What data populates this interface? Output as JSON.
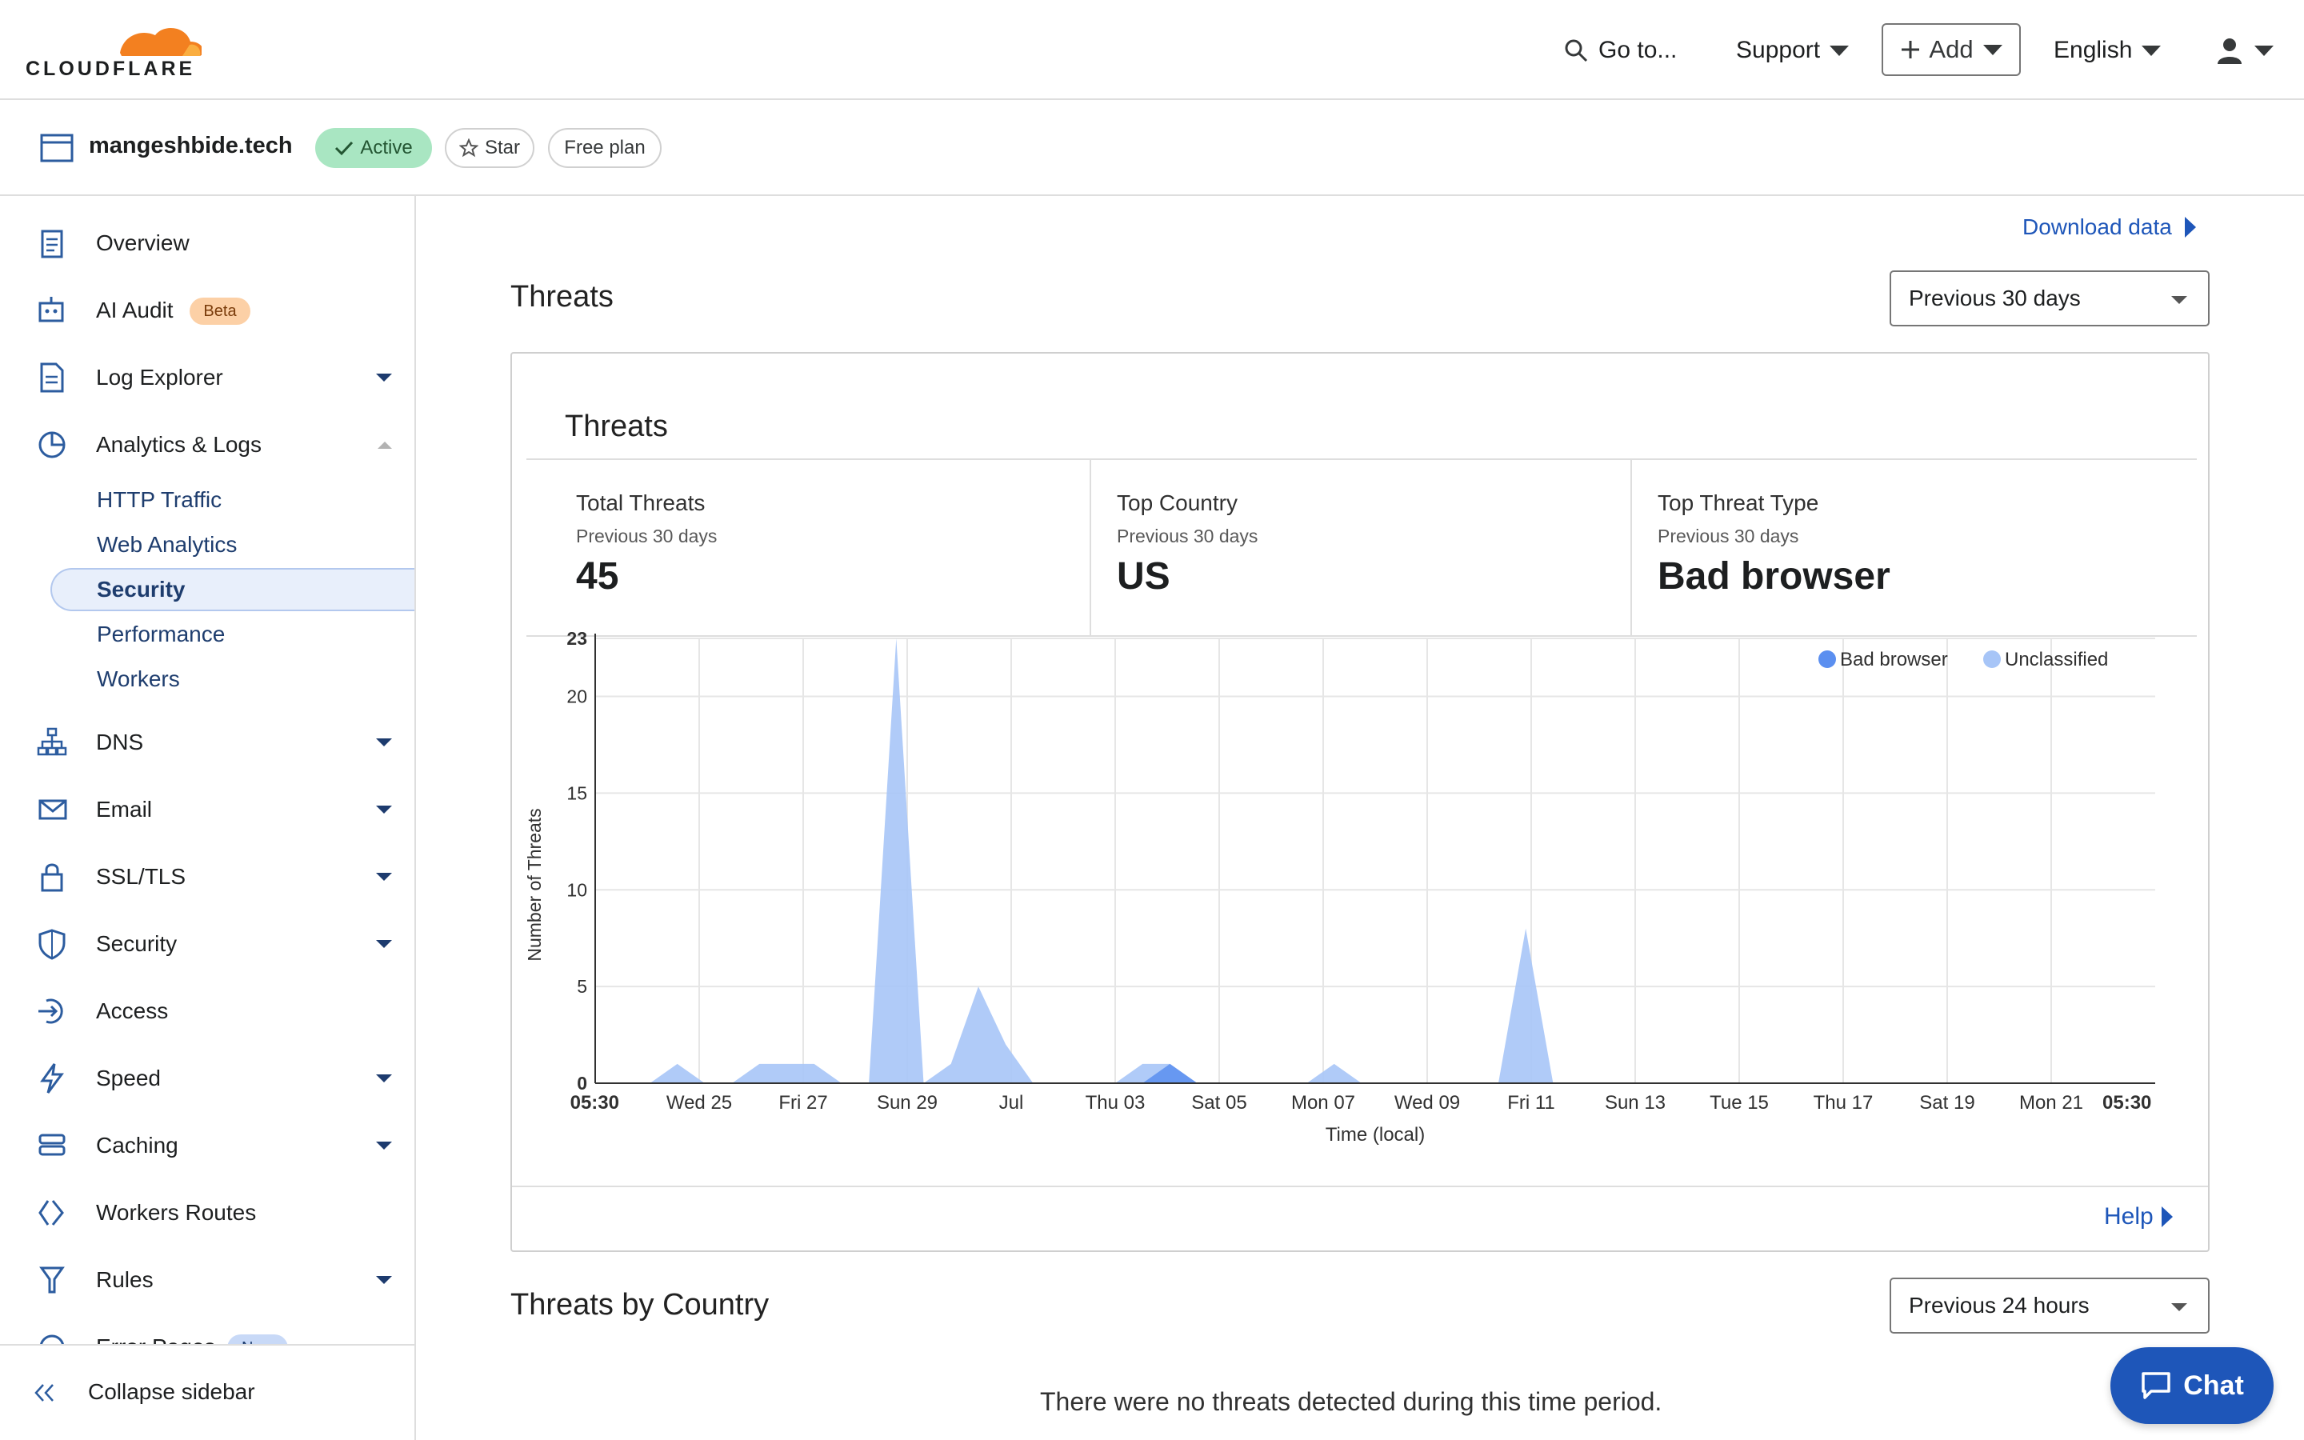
{
  "brand": {
    "name": "CLOUDFLARE",
    "orange": "#f38020"
  },
  "topnav": {
    "search_label": "Go to...",
    "support_label": "Support",
    "add_label": "Add",
    "language_label": "English"
  },
  "zone": {
    "domain": "mangeshbide.tech",
    "status": "Active",
    "star_label": "Star",
    "plan": "Free plan"
  },
  "sidebar": {
    "items": [
      {
        "label": "Overview"
      },
      {
        "label": "AI Audit",
        "badge": "Beta"
      },
      {
        "label": "Log Explorer"
      },
      {
        "label": "Analytics & Logs"
      },
      {
        "label": "DNS"
      },
      {
        "label": "Email"
      },
      {
        "label": "SSL/TLS"
      },
      {
        "label": "Security"
      },
      {
        "label": "Access"
      },
      {
        "label": "Speed"
      },
      {
        "label": "Caching"
      },
      {
        "label": "Workers Routes"
      },
      {
        "label": "Rules"
      },
      {
        "label": "Error Pages",
        "badge": "New"
      }
    ],
    "analytics_sub": [
      "HTTP Traffic",
      "Web Analytics",
      "Security",
      "Performance",
      "Workers"
    ],
    "collapse_label": "Collapse sidebar"
  },
  "main": {
    "download_label": "Download data",
    "section_title": "Threats",
    "range_select": "Previous 30 days",
    "card_title": "Threats",
    "stats": [
      {
        "label": "Total Threats",
        "sub": "Previous 30 days",
        "value": "45"
      },
      {
        "label": "Top Country",
        "sub": "Previous 30 days",
        "value": "US"
      },
      {
        "label": "Top Threat Type",
        "sub": "Previous 30 days",
        "value": "Bad browser"
      }
    ],
    "help_label": "Help",
    "country_title": "Threats by Country",
    "country_select": "Previous 24 hours",
    "no_threats": "There were no threats detected during this time period.",
    "chat_label": "Chat"
  },
  "chart_data": {
    "type": "area",
    "xlabel": "Time (local)",
    "ylabel": "Number of Threats",
    "ylim": [
      0,
      23
    ],
    "yticks": [
      0,
      5,
      10,
      15,
      20,
      23
    ],
    "xticks": [
      "05:30",
      "Wed 25",
      "Fri 27",
      "Sun 29",
      "Jul",
      "Thu 03",
      "Sat 05",
      "Mon 07",
      "Wed 09",
      "Fri 11",
      "Sun 13",
      "Tue 15",
      "Thu 17",
      "Sat 19",
      "Mon 21",
      "05:30"
    ],
    "legend_position": "top-right",
    "colors": {
      "Bad browser": "#5b8ff0",
      "Unclassified": "#a7c5f7"
    },
    "series": [
      {
        "name": "Bad browser",
        "values": [
          0,
          0,
          0,
          0,
          0,
          0,
          0,
          0,
          0,
          0,
          0,
          0,
          0,
          0,
          0,
          0,
          0,
          0,
          0,
          0,
          0,
          1,
          0,
          0,
          0,
          0,
          0,
          0,
          0,
          0,
          0,
          0,
          0,
          0,
          0,
          0,
          0,
          0,
          0,
          0,
          0,
          0,
          0,
          0,
          0,
          0,
          0,
          0,
          0,
          0,
          0,
          0,
          0,
          0,
          0,
          0,
          0,
          0
        ]
      },
      {
        "name": "Unclassified",
        "values": [
          0,
          0,
          0,
          1,
          0,
          0,
          1,
          1,
          1,
          0,
          0,
          23,
          0,
          1,
          5,
          2,
          0,
          0,
          0,
          0,
          1,
          1,
          0,
          0,
          0,
          0,
          0,
          1,
          0,
          0,
          0,
          0,
          0,
          0,
          8,
          0,
          0,
          0,
          0,
          0,
          0,
          0,
          0,
          0,
          0,
          0,
          0,
          0,
          0,
          0,
          0,
          0,
          0,
          0,
          0,
          0,
          0,
          0
        ]
      }
    ]
  }
}
